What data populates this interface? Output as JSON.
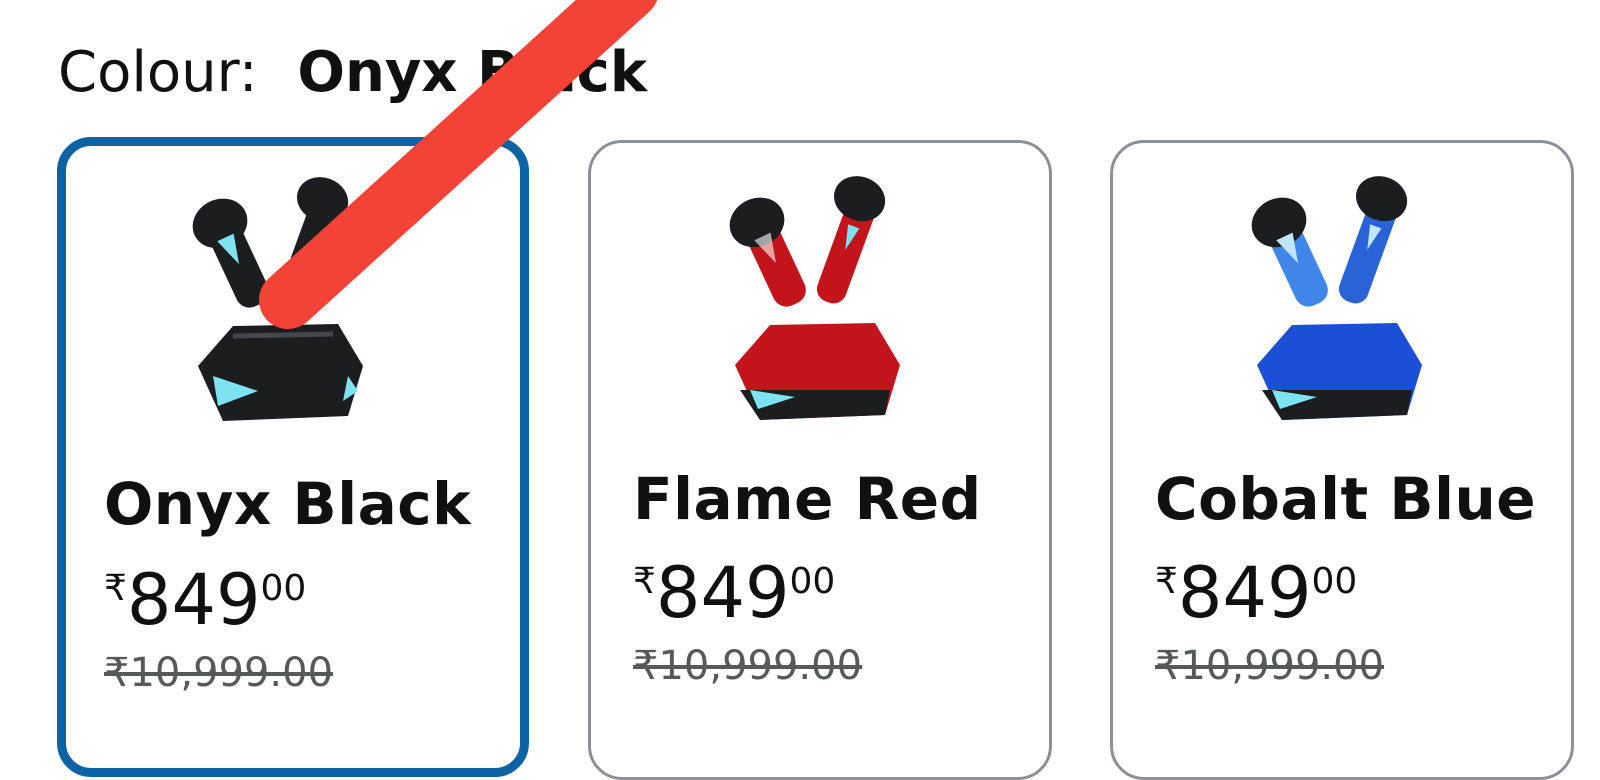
{
  "colour_selector": {
    "label": "Colour:",
    "selected_value": "Onyx Black"
  },
  "variants": [
    {
      "name": "Onyx Black",
      "currency": "₹",
      "price_whole": "849",
      "price_fraction": "00",
      "mrp": "₹10,999.00",
      "selected": true,
      "case_color": "#1b1d20",
      "accent_color": "#7ee3f0"
    },
    {
      "name": "Flame Red",
      "currency": "₹",
      "price_whole": "849",
      "price_fraction": "00",
      "mrp": "₹10,999.00",
      "selected": false,
      "case_color": "#c3141b",
      "accent_color": "#7ee3f0"
    },
    {
      "name": "Cobalt Blue",
      "currency": "₹",
      "price_whole": "849",
      "price_fraction": "00",
      "mrp": "₹10,999.00",
      "selected": false,
      "case_color": "#1a4fd6",
      "accent_color": "#7ee3f0"
    }
  ],
  "colors": {
    "selected_border": "#0b63a5",
    "card_border": "#8d9096",
    "annotation_stroke": "#f44336"
  }
}
